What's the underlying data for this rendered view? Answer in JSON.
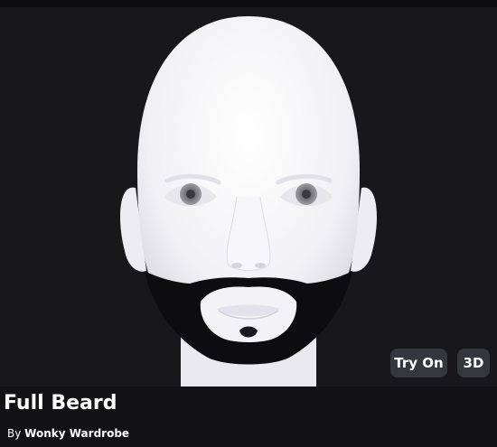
{
  "item": {
    "title": "Full Beard",
    "by_prefix": "By",
    "creator": "Wonky Wardrobe"
  },
  "preview": {
    "image_subject": "head-with-full-beard",
    "background_color": "#18181b"
  },
  "actions": {
    "try_on_label": "Try On",
    "view_3d_label": "3D"
  },
  "colors": {
    "page_background": "#121215",
    "button_background": "#36373d",
    "text": "#ffffff"
  }
}
